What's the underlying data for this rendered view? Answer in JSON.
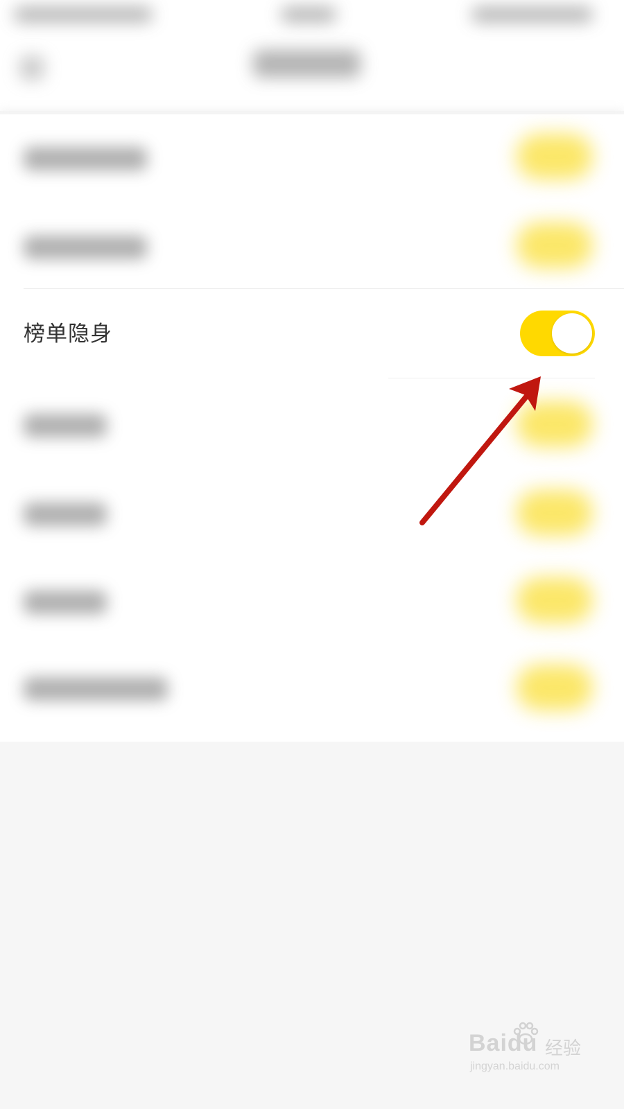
{
  "settings": {
    "visible_row": {
      "label": "榜单隐身",
      "toggle_on": true
    }
  },
  "colors": {
    "toggle_on": "#ffd900",
    "annotation_arrow": "#c0170f",
    "label_text": "#333333"
  },
  "icons": {
    "annotation": "red-arrow-icon",
    "watermark_paw": "paw-icon"
  },
  "watermark": {
    "brand": "Baidu",
    "product": "经验",
    "url": "jingyan.baidu.com"
  }
}
